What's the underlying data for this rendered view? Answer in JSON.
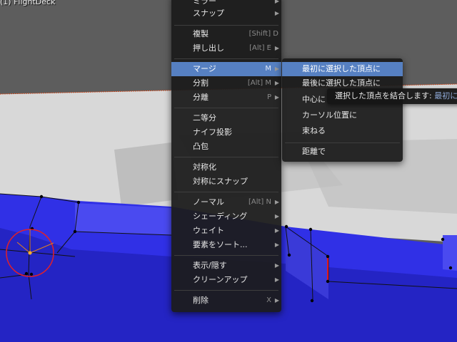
{
  "viewport": {
    "object_label": "(1) FlightDeck",
    "colors": {
      "selected_faces": "#2f2fe0",
      "floor": "#d8d8d8",
      "background": "#5a5a5a",
      "cursor_circle": "#e0202a"
    }
  },
  "menu": {
    "items": [
      {
        "label": "ミラー",
        "submenu": true
      },
      {
        "label": "スナップ",
        "submenu": true
      },
      {
        "label": "複製",
        "shortcut": "[Shift] D"
      },
      {
        "label": "押し出し",
        "shortcut": "[Alt] E",
        "submenu": true
      },
      {
        "label": "マージ",
        "shortcut": "M",
        "submenu": true,
        "active": true
      },
      {
        "label": "分割",
        "shortcut": "[Alt] M",
        "submenu": true
      },
      {
        "label": "分離",
        "shortcut": "P",
        "submenu": true
      },
      {
        "label": "二等分"
      },
      {
        "label": "ナイフ投影"
      },
      {
        "label": "凸包"
      },
      {
        "label": "対称化"
      },
      {
        "label": "対称にスナップ"
      },
      {
        "label": "ノーマル",
        "shortcut": "[Alt] N",
        "submenu": true
      },
      {
        "label": "シェーディング",
        "submenu": true
      },
      {
        "label": "ウェイト",
        "submenu": true
      },
      {
        "label": "要素をソート...",
        "submenu": true
      },
      {
        "label": "表示/隠す",
        "submenu": true
      },
      {
        "label": "クリーンアップ",
        "submenu": true
      },
      {
        "label": "削除",
        "shortcut": "X",
        "submenu": true
      }
    ],
    "arrow_glyph": "▶"
  },
  "submenu": {
    "items": [
      {
        "label": "最初に選択した頂点に",
        "active": true
      },
      {
        "label": "最後に選択した頂点に"
      },
      {
        "label": "中心に"
      },
      {
        "label": "カーソル位置に"
      },
      {
        "label": "束ねる"
      },
      {
        "label": "距離で"
      }
    ]
  },
  "tooltip": {
    "text": "選択した頂点を結合します: ",
    "value": "最初に"
  }
}
